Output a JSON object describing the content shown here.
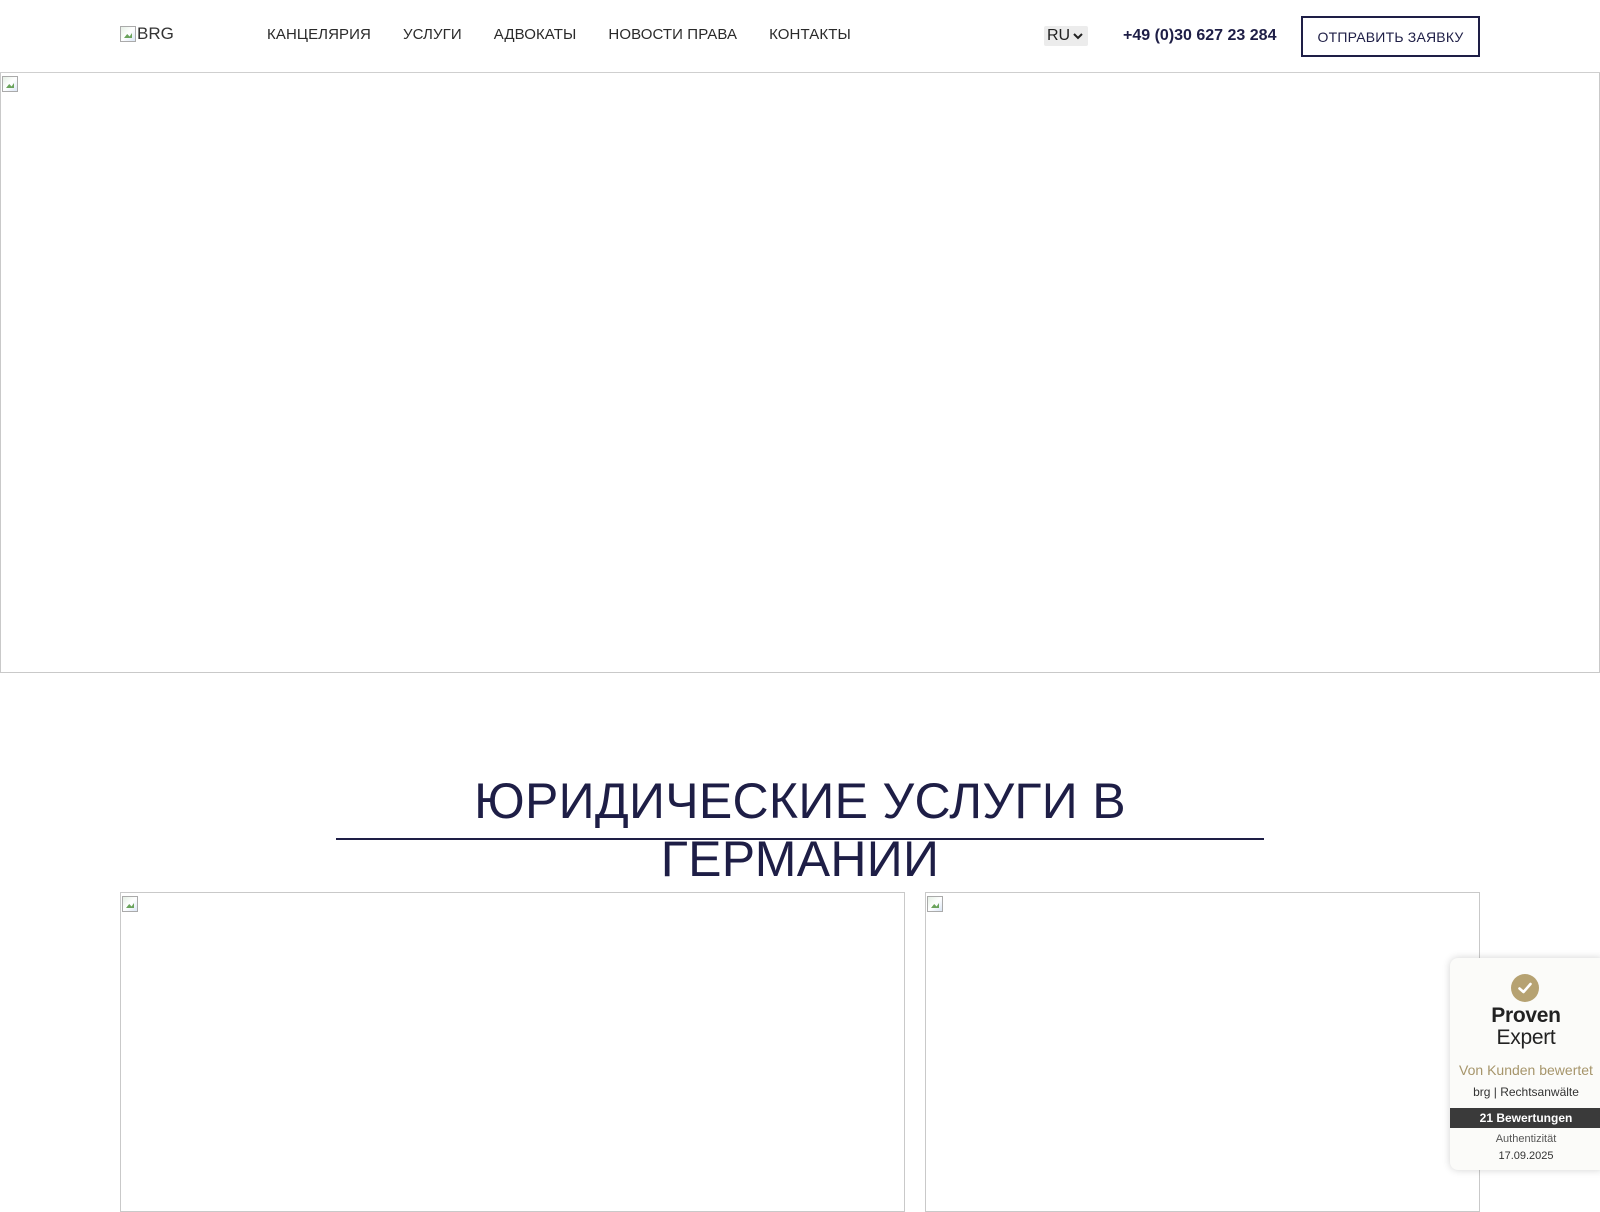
{
  "header": {
    "logo_alt": "BRG",
    "nav": [
      {
        "label": "КАНЦЕЛЯРИЯ"
      },
      {
        "label": "УСЛУГИ"
      },
      {
        "label": "АДВОКАТЫ"
      },
      {
        "label": "НОВОСТИ ПРАВА"
      },
      {
        "label": "КОНТАКТЫ"
      }
    ],
    "language": "RU",
    "phone": "+49 (0)30 627 23 284",
    "cta_label": "ОТПРАВИТЬ ЗАЯВКУ"
  },
  "main": {
    "section_title": "ЮРИДИЧЕСКИЕ УСЛУГИ В ГЕРМАНИИ"
  },
  "widget": {
    "brand_line1": "Proven",
    "brand_line2": "Expert",
    "tagline": "Von Kunden bewertet",
    "company": "brg | Rechtsanwälte",
    "reviews": "21 Bewertungen",
    "authenticity": "Authentizität",
    "date": "17.09.2025"
  },
  "colors": {
    "brand_navy": "#1e1e46",
    "widget_gold": "#b6a272",
    "widget_bar": "#3a3a3a"
  },
  "icons": {
    "broken_image": "broken-image-icon",
    "check": "check-icon",
    "dropdown": "chevron-down-icon"
  }
}
